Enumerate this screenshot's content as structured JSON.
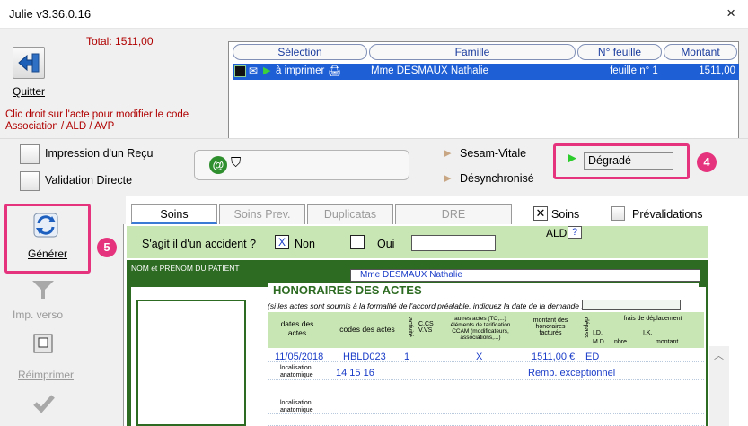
{
  "window": {
    "title": "Julie v3.36.0.16",
    "close": "×"
  },
  "top": {
    "total": "Total: 1511,00",
    "quit": "Quitter",
    "hint": "Clic droit sur l'acte pour modifier le code Association / ALD / AVP"
  },
  "grid": {
    "headers": [
      "Sélection",
      "Famille",
      "N° feuille",
      "Montant"
    ],
    "row": {
      "status": "à imprimer",
      "patient": "Mme DESMAUX Nathalie",
      "sheet": "feuille n° 1",
      "amount": "1511,00"
    }
  },
  "status": {
    "receipt": "Impression d'un Reçu",
    "direct": "Validation Directe",
    "sesam": "Sesam-Vitale",
    "desync": "Désynchronisé",
    "degraded": "Dégradé",
    "badge4": "4",
    "badge5": "5",
    "at_icon": "@"
  },
  "tools": {
    "generate": "Générer",
    "verso": "Imp. verso",
    "reprint": "Réimprimer"
  },
  "tabs": [
    "Soins",
    "Soins Prev.",
    "Duplicatas",
    "DRE"
  ],
  "checks": {
    "soins": "Soins",
    "prevalid": "Prévalidations"
  },
  "form": {
    "accident_q": "S'agit il d'un accident ?",
    "no": "Non",
    "yes": "Oui",
    "no_mark": "X",
    "ald": "ALD",
    "ald_q": "?",
    "patient_lbl": "NOM et PRENOM DU PATIENT",
    "patient": "Mme DESMAUX Nathalie",
    "honoraires": "HONORAIRES DES ACTES",
    "note": "(si les actes sont soumis à la formalité de l'accord préalable, indiquez la date de la demande :",
    "col_date": "dates des actes",
    "col_codes": "codes des actes",
    "col_activite": "activité",
    "col_ccvs": "C.CS V.VS",
    "col_autres": "autres actes (TO,...) éléments de tarification CCAM (modificateurs, associations,...)",
    "col_montant": "montant des honoraires facturés",
    "col_depass": "dépass.",
    "col_frais": "frais de déplacement",
    "col_id": "I.D.",
    "col_md": "M.D.",
    "col_nbre": "nbre",
    "col_ik": "I.K.",
    "col_montant2": "montant",
    "row_date": "11/05/2018",
    "row_code": "HBLD023",
    "row_act": "1",
    "row_x": "X",
    "row_amount": "1511,00 €",
    "row_ed": "ED",
    "loc_lbl": "localisation anatomique",
    "loc_val": "14 15 16",
    "remb": "Remb. exceptionnel"
  }
}
